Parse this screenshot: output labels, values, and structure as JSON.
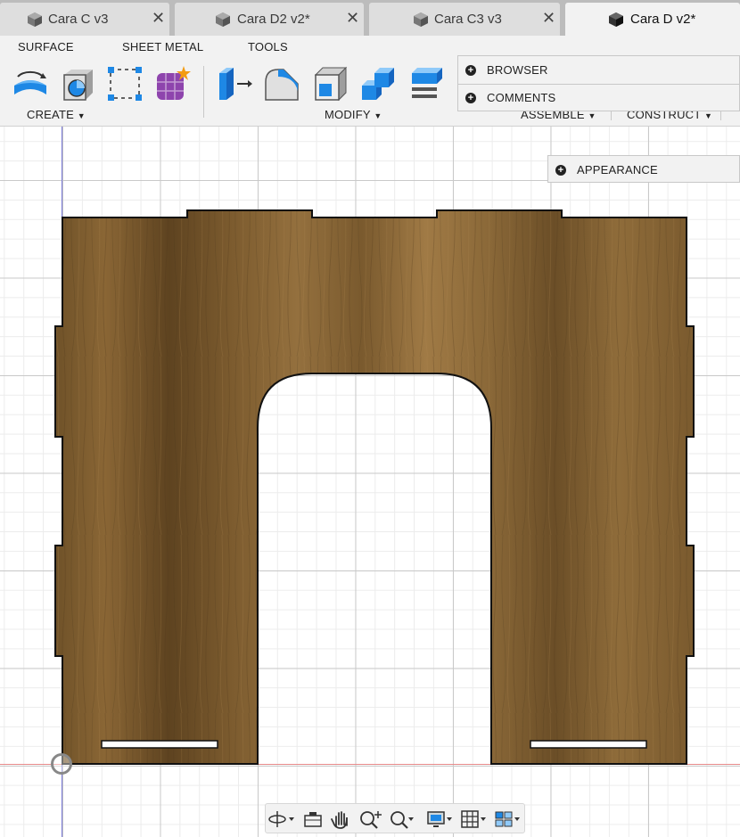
{
  "tabs": [
    {
      "label": "Cara C v3",
      "active": false
    },
    {
      "label": "Cara D2 v2*",
      "active": false
    },
    {
      "label": "Cara C3 v3",
      "active": false
    },
    {
      "label": "Cara D v2*",
      "active": true
    }
  ],
  "toolbar": {
    "tabs": [
      "SURFACE",
      "SHEET METAL",
      "TOOLS"
    ],
    "groups": {
      "create": "CREATE",
      "modify": "MODIFY",
      "assemble": "ASSEMBLE",
      "construct": "CONSTRUCT"
    },
    "create_tools": [
      "extrude-icon",
      "revolve-icon",
      "sketch-rectangle-icon",
      "form-icon"
    ],
    "modify_tools": [
      "press-pull-icon",
      "fillet-icon",
      "shell-icon",
      "combine-icon",
      "scale-icon"
    ]
  },
  "panels": {
    "browser": "BROWSER",
    "comments": "COMMENTS",
    "appearance": "APPEARANCE"
  },
  "nav_tools": [
    "orbit-icon",
    "look-at-icon",
    "pan-icon",
    "zoom-icon",
    "fit-icon",
    "display-settings-icon",
    "grid-settings-icon",
    "viewports-icon"
  ],
  "colors": {
    "wood": "#7a5a2e",
    "wood_dark": "#5c421f",
    "wood_light": "#9a7440",
    "accent_blue": "#1e88e5",
    "axis_x": "#e88a8a",
    "axis_y": "#7a7ad8"
  }
}
